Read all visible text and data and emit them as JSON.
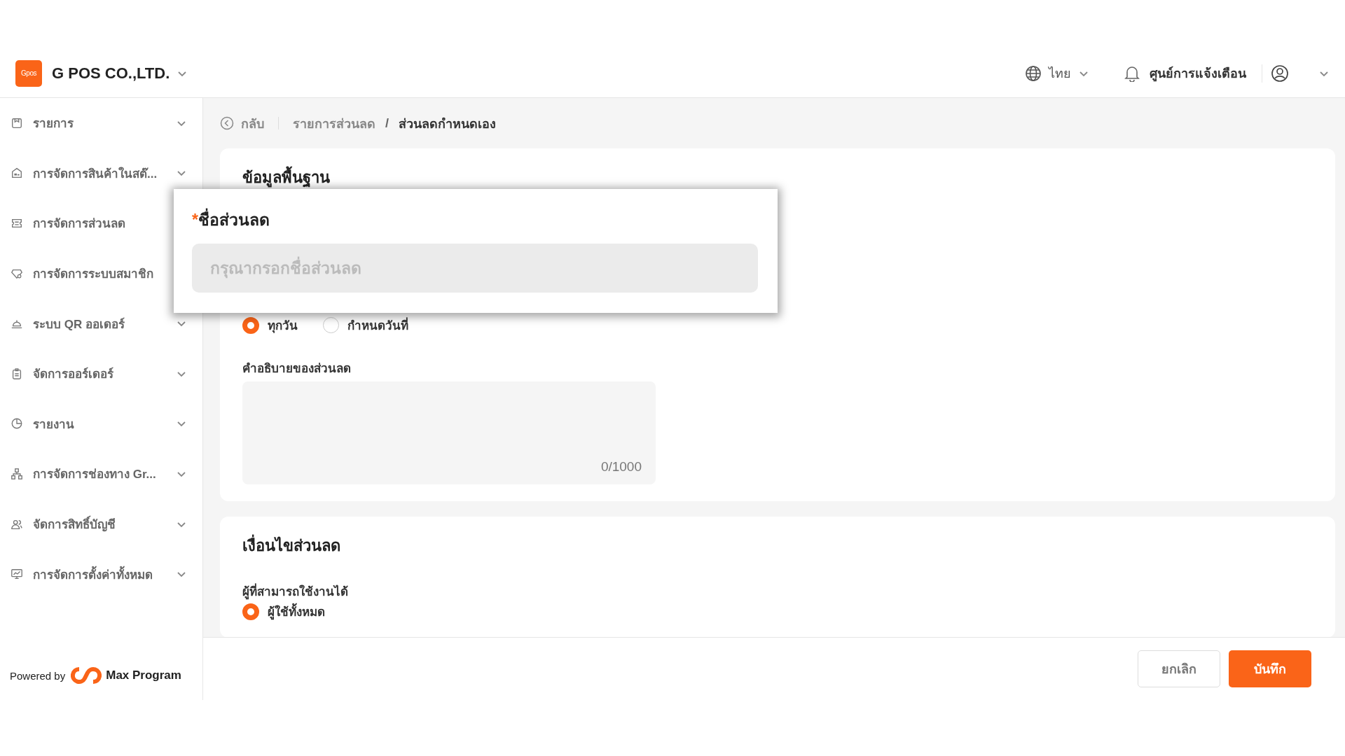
{
  "company": {
    "logo": "Gpos",
    "name": "G POS CO.,LTD."
  },
  "header": {
    "language": "ไทย",
    "notifications": "ศูนย์การแจ้งเตือน"
  },
  "sidebar": {
    "items": [
      {
        "label": "รายการ",
        "kind": "list",
        "chevron": true
      },
      {
        "label": "การจัดการสินค้าในสต๊...",
        "kind": "store",
        "chevron": true
      },
      {
        "label": "การจัดการส่วนลด",
        "kind": "ticket",
        "chevron": false
      },
      {
        "label": "การจัดการระบบสมาชิก",
        "kind": "gem",
        "chevron": false
      },
      {
        "label": "ระบบ QR ออเดอร์",
        "kind": "bell",
        "chevron": true
      },
      {
        "label": "จัดการออร์เดอร์",
        "kind": "clipboard",
        "chevron": true
      },
      {
        "label": "รายงาน",
        "kind": "pie",
        "chevron": true
      },
      {
        "label": "การจัดการช่องทาง Gr...",
        "kind": "network",
        "chevron": true
      },
      {
        "label": "จัดการสิทธิ์บัญชี",
        "kind": "users",
        "chevron": true
      },
      {
        "label": "การจัดการตั้งค่าทั้งหมด",
        "kind": "monitor",
        "chevron": true
      }
    ]
  },
  "powered_by": {
    "prefix": "Powered by",
    "brand": "Max Program"
  },
  "breadcrumb": {
    "back": "กลับ",
    "separator": "/",
    "items": [
      {
        "label": "รายการส่วนลด",
        "current": false
      },
      {
        "label": "ส่วนลดกำหนดเอง",
        "current": true
      }
    ]
  },
  "basic_info": {
    "title": "ข้อมูลพื้นฐาน",
    "schedule_options": [
      {
        "label": "ทุกวัน",
        "selected": true
      },
      {
        "label": "กำหนดวันที่",
        "selected": false
      }
    ],
    "description": {
      "label": "คำอธิบายของส่วนลด",
      "counter": "0/1000"
    }
  },
  "conditions": {
    "title": "เงื่อนไขส่วนลด",
    "users_label": "ผู้ที่สามารถใช้งานได้",
    "user_options": [
      {
        "label": "ผู้ใช้ทั้งหมด",
        "selected": true
      }
    ]
  },
  "popup": {
    "label": "ชื่อส่วนลด",
    "required_mark": "*",
    "placeholder": "กรุณากรอกชื่อส่วนลด"
  },
  "buttons": {
    "cancel": "ยกเลิก",
    "save": "บันทึก"
  }
}
